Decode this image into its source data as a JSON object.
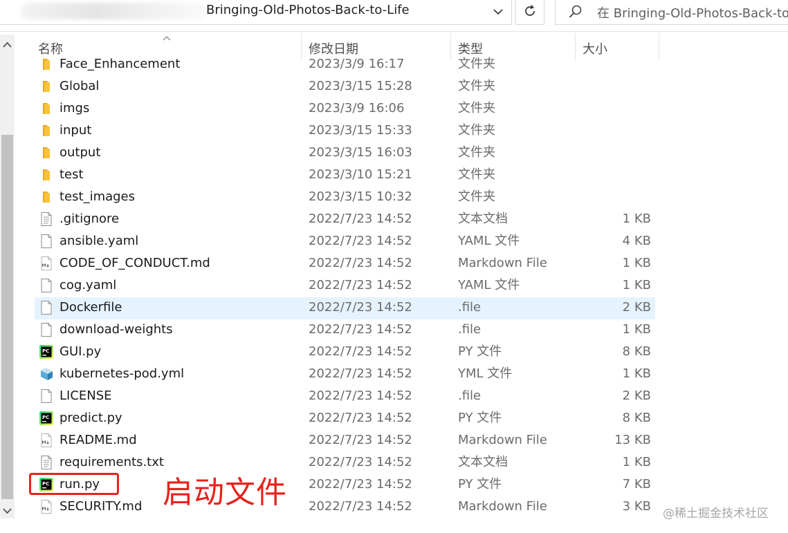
{
  "address_bar": {
    "path_tail": "Bringing-Old-Photos-Back-to-Life"
  },
  "search": {
    "placeholder": "在 Bringing-Old-Photos-Back-to"
  },
  "columns": {
    "name": "名称",
    "date": "修改日期",
    "type": "类型",
    "size": "大小"
  },
  "files": [
    {
      "name": "Face_Enhancement",
      "date": "2023/3/9 16:17",
      "type": "文件夹",
      "size": "",
      "icon": "folder-icon"
    },
    {
      "name": "Global",
      "date": "2023/3/15 15:28",
      "type": "文件夹",
      "size": "",
      "icon": "folder-icon"
    },
    {
      "name": "imgs",
      "date": "2023/3/9 16:06",
      "type": "文件夹",
      "size": "",
      "icon": "folder-icon"
    },
    {
      "name": "input",
      "date": "2023/3/15 15:33",
      "type": "文件夹",
      "size": "",
      "icon": "folder-icon"
    },
    {
      "name": "output",
      "date": "2023/3/15 16:03",
      "type": "文件夹",
      "size": "",
      "icon": "folder-icon"
    },
    {
      "name": "test",
      "date": "2023/3/10 15:21",
      "type": "文件夹",
      "size": "",
      "icon": "folder-icon"
    },
    {
      "name": "test_images",
      "date": "2023/3/15 10:32",
      "type": "文件夹",
      "size": "",
      "icon": "folder-icon"
    },
    {
      "name": ".gitignore",
      "date": "2022/7/23 14:52",
      "type": "文本文档",
      "size": "1 KB",
      "icon": "text-file-icon"
    },
    {
      "name": "ansible.yaml",
      "date": "2022/7/23 14:52",
      "type": "YAML 文件",
      "size": "4 KB",
      "icon": "blank-file-icon"
    },
    {
      "name": "CODE_OF_CONDUCT.md",
      "date": "2022/7/23 14:52",
      "type": "Markdown File",
      "size": "1 KB",
      "icon": "markdown-file-icon"
    },
    {
      "name": "cog.yaml",
      "date": "2022/7/23 14:52",
      "type": "YAML 文件",
      "size": "1 KB",
      "icon": "blank-file-icon"
    },
    {
      "name": "Dockerfile",
      "date": "2022/7/23 14:52",
      "type": ".file",
      "size": "2 KB",
      "icon": "blank-file-icon",
      "selected": true
    },
    {
      "name": "download-weights",
      "date": "2022/7/23 14:52",
      "type": ".file",
      "size": "1 KB",
      "icon": "blank-file-icon"
    },
    {
      "name": "GUI.py",
      "date": "2022/7/23 14:52",
      "type": "PY 文件",
      "size": "8 KB",
      "icon": "pycharm-file-icon"
    },
    {
      "name": "kubernetes-pod.yml",
      "date": "2022/7/23 14:52",
      "type": "YML 文件",
      "size": "1 KB",
      "icon": "yml-file-icon"
    },
    {
      "name": "LICENSE",
      "date": "2022/7/23 14:52",
      "type": ".file",
      "size": "2 KB",
      "icon": "blank-file-icon"
    },
    {
      "name": "predict.py",
      "date": "2022/7/23 14:52",
      "type": "PY 文件",
      "size": "8 KB",
      "icon": "pycharm-file-icon"
    },
    {
      "name": "README.md",
      "date": "2022/7/23 14:52",
      "type": "Markdown File",
      "size": "13 KB",
      "icon": "markdown-file-icon"
    },
    {
      "name": "requirements.txt",
      "date": "2022/7/23 14:52",
      "type": "文本文档",
      "size": "1 KB",
      "icon": "text-file-icon"
    },
    {
      "name": "run.py",
      "date": "2022/7/23 14:52",
      "type": "PY 文件",
      "size": "7 KB",
      "icon": "pycharm-file-icon"
    },
    {
      "name": "SECURITY.md",
      "date": "2022/7/23 14:52",
      "type": "Markdown File",
      "size": "3 KB",
      "icon": "markdown-file-icon"
    }
  ],
  "annotation": {
    "text": "启动文件",
    "color": "#e8211b"
  },
  "watermark": "@稀土掘金技术社区",
  "colors": {
    "selection": "#e5f3ff",
    "folder": "#f8c33a",
    "pycharm_green": "#21d789"
  }
}
